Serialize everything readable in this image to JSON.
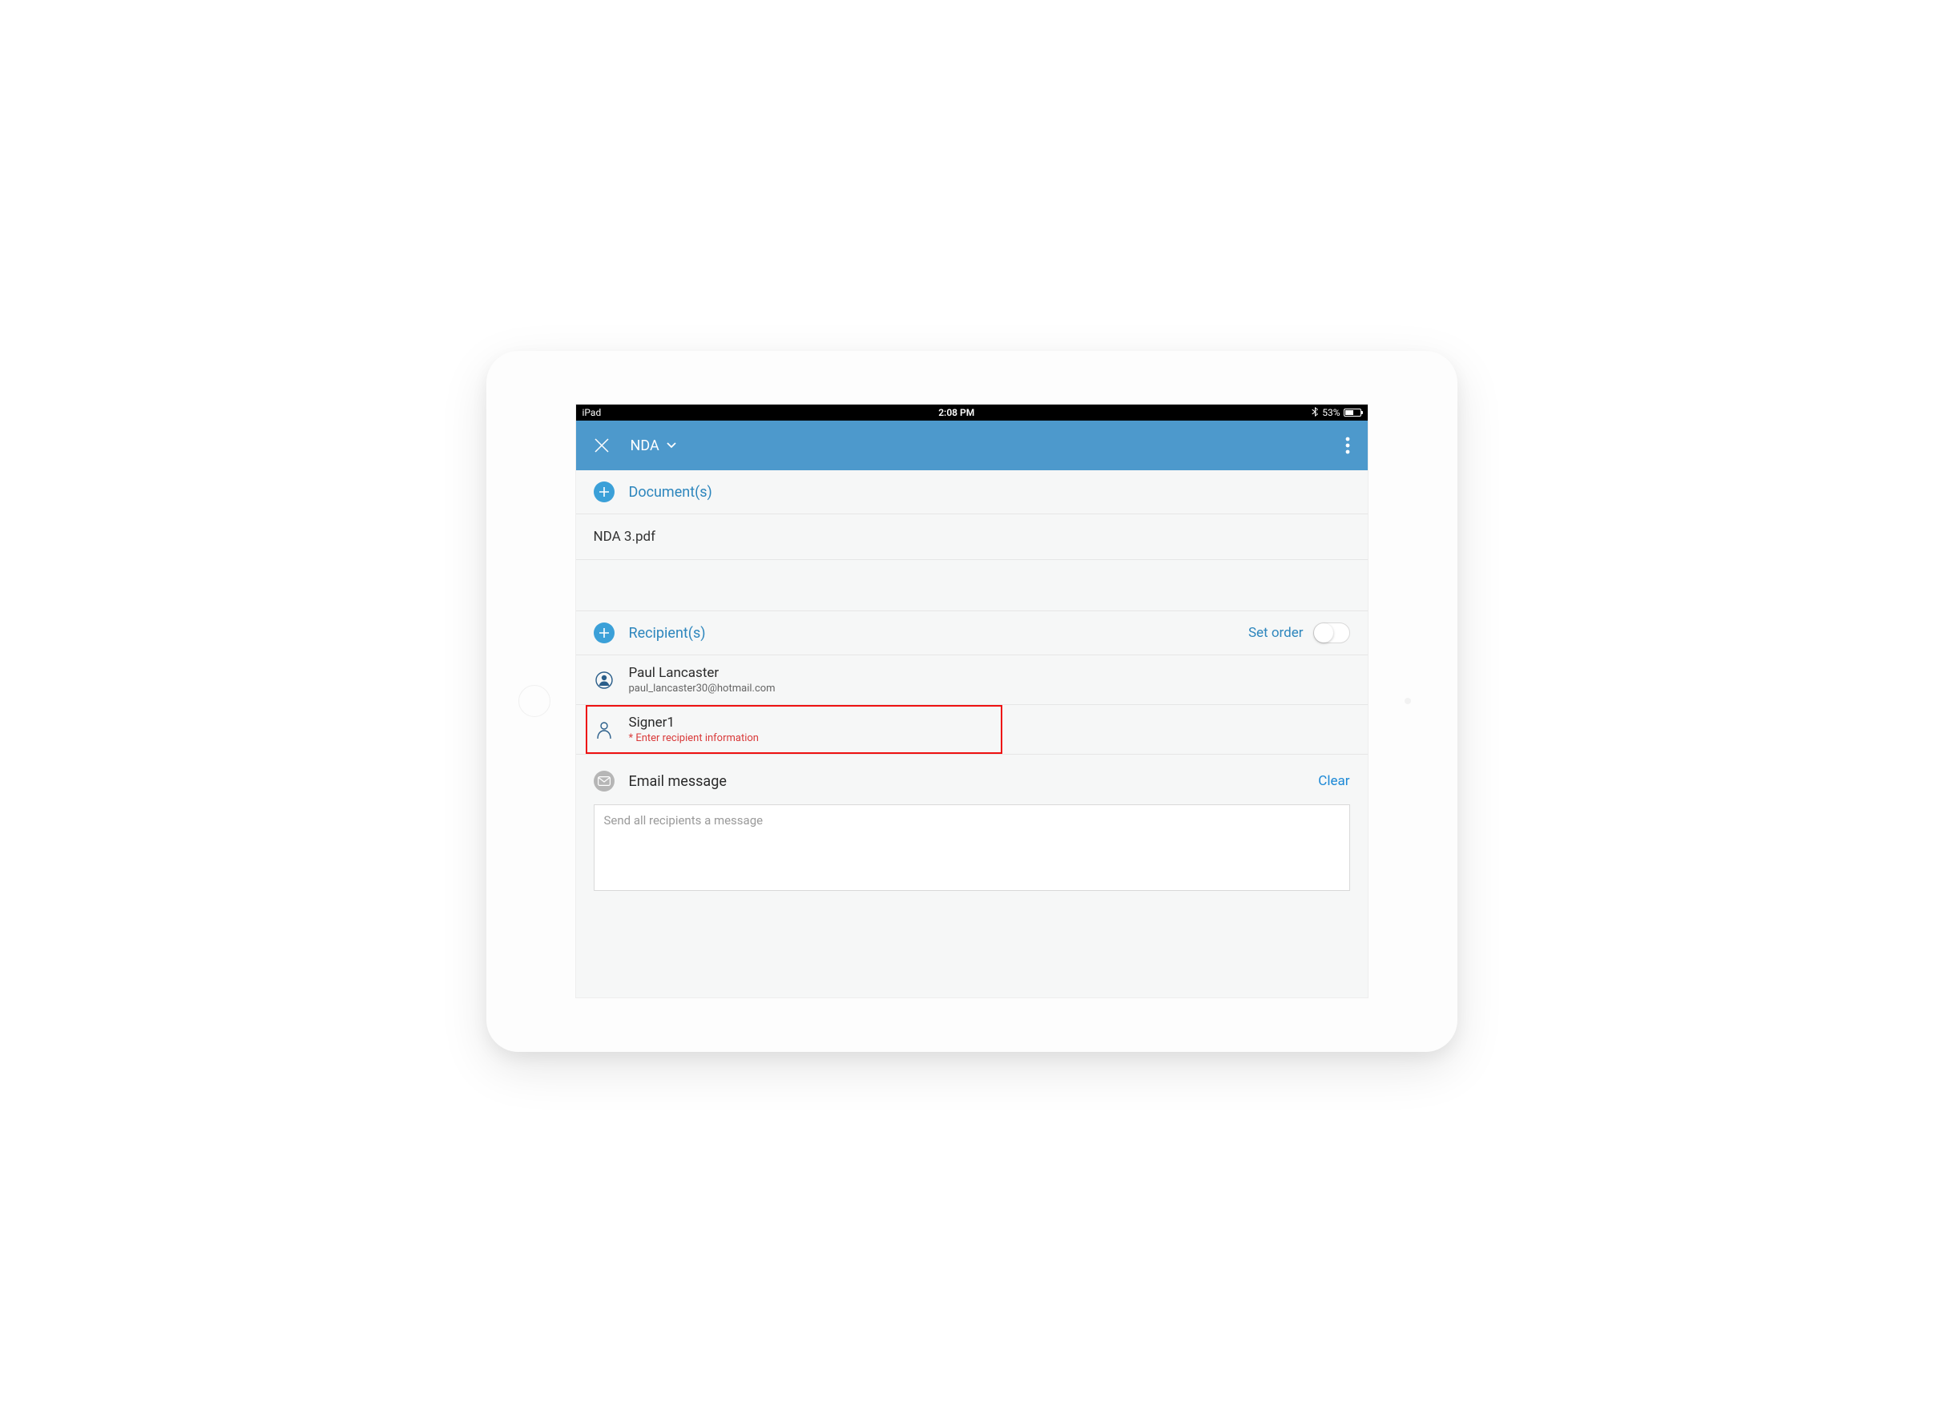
{
  "status_bar": {
    "device": "iPad",
    "time": "2:08 PM",
    "battery_percent": "53%",
    "bluetooth": true
  },
  "header": {
    "title": "NDA"
  },
  "documents": {
    "section_label": "Document(s)",
    "files": [
      {
        "name": "NDA 3.pdf"
      }
    ]
  },
  "recipients": {
    "section_label": "Recipient(s)",
    "set_order_label": "Set order",
    "set_order_enabled": false,
    "items": [
      {
        "name": "Paul Lancaster",
        "email": "paul_lancaster30@hotmail.com",
        "filled": true
      },
      {
        "name": "Signer1",
        "error": "* Enter recipient information",
        "filled": false
      }
    ]
  },
  "email": {
    "section_label": "Email message",
    "clear_label": "Clear",
    "placeholder": "Send all recipients a message"
  },
  "colors": {
    "header_bg": "#4d99cc",
    "accent": "#2d86bd",
    "error": "#d93a3a"
  }
}
